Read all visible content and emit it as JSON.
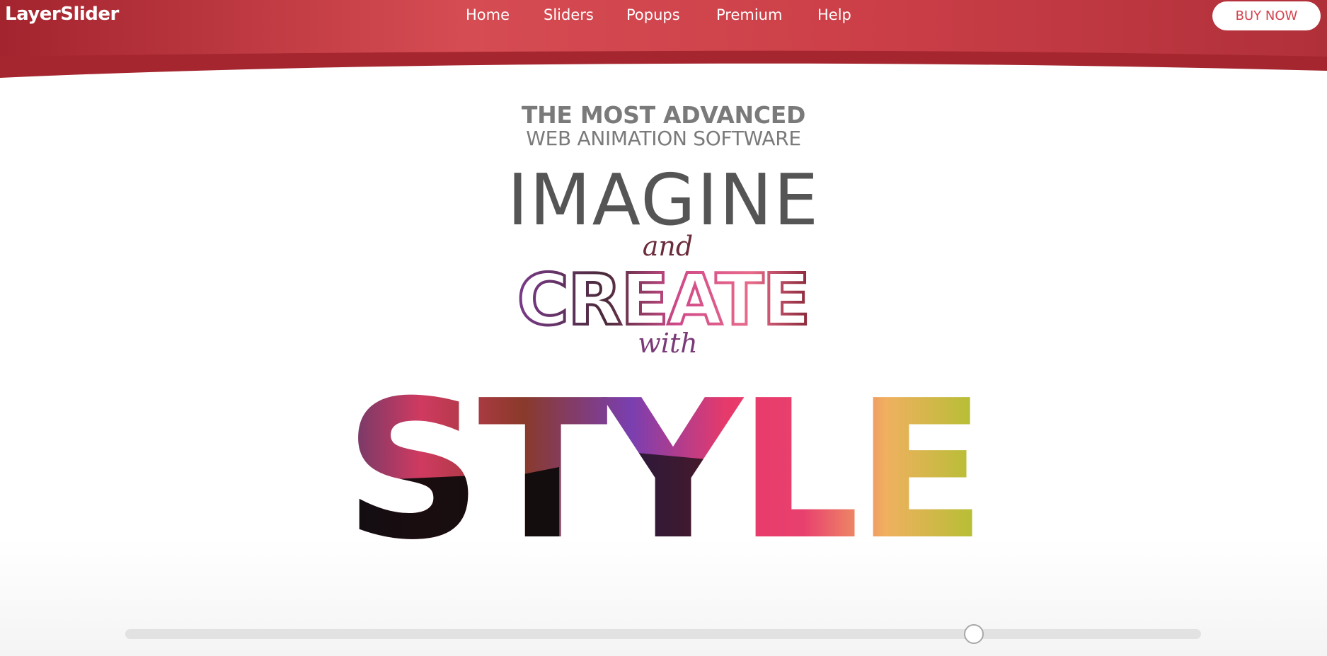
{
  "brand": {
    "logo_text": "LayerSlider",
    "primary_color": "#d4434d",
    "primary_dark": "#a92a33"
  },
  "nav": {
    "items": [
      {
        "label": "Home"
      },
      {
        "label": "Sliders"
      },
      {
        "label": "Popups"
      },
      {
        "label": "Premium"
      },
      {
        "label": "Help"
      }
    ],
    "buy_label": "BUY NOW"
  },
  "hero": {
    "tagline_bold": "THE MOST ADVANCED",
    "tagline_light": "WEB ANIMATION SOFTWARE",
    "word_imagine": "IMAGINE",
    "word_and": "and",
    "word_create": "CREATE",
    "word_with": "with",
    "word_style": "STYLE",
    "style_gradient_colors": [
      "#8b2a5a",
      "#e23a6a",
      "#7a3fb0",
      "#e8406e",
      "#f0a030",
      "#b0c030",
      "#0a0a0a"
    ]
  },
  "slider": {
    "progress_fraction": 0.789
  }
}
